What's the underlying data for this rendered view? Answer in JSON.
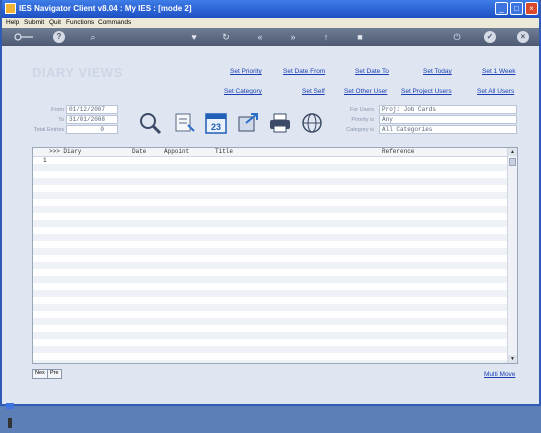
{
  "window": {
    "title": "IES Navigator Client v8.04 : My IES :      [mode 2]",
    "min_icon": "minimize-icon",
    "max_icon": "maximize-icon",
    "close_icon": "close-icon"
  },
  "menu": [
    "Help",
    "Submit",
    "Quit",
    "Functions",
    "Commands"
  ],
  "nav": {
    "question": "?",
    "search": "⌕",
    "back": "«",
    "forward": "»",
    "info": "i"
  },
  "header": {
    "title": "DIARY VIEWS"
  },
  "links_row1": [
    "Set Priority",
    "Set Date From",
    "Set Date To",
    "Set Today",
    "Set 1 Week"
  ],
  "links_row2": [
    "Set Category",
    "Set Self",
    "Set Other User",
    "Set Project Users",
    "Set All Users"
  ],
  "filters_left": [
    {
      "label": "From",
      "value": "01/12/2007"
    },
    {
      "label": "To",
      "value": "31/01/2008"
    },
    {
      "label": "Total Entries",
      "value": "0"
    }
  ],
  "filters_right": [
    {
      "label": "For Users",
      "value": "Proj: Job Cards"
    },
    {
      "label": "Priority is",
      "value": "Any"
    },
    {
      "label": "Category is",
      "value": "All Categories"
    }
  ],
  "toolbar_icons": [
    "magnifier-icon",
    "note-icon",
    "calendar-icon",
    "export-icon",
    "printer-icon",
    "globe-icon"
  ],
  "calendar_day": "23",
  "grid": {
    "columns": [
      ">>> Diary",
      "Date",
      "Appoint",
      "Title",
      "Reference"
    ],
    "row_number": "1"
  },
  "footer": {
    "next": "Nex",
    "prev": "Pre",
    "multi_move": "Multi Move"
  }
}
